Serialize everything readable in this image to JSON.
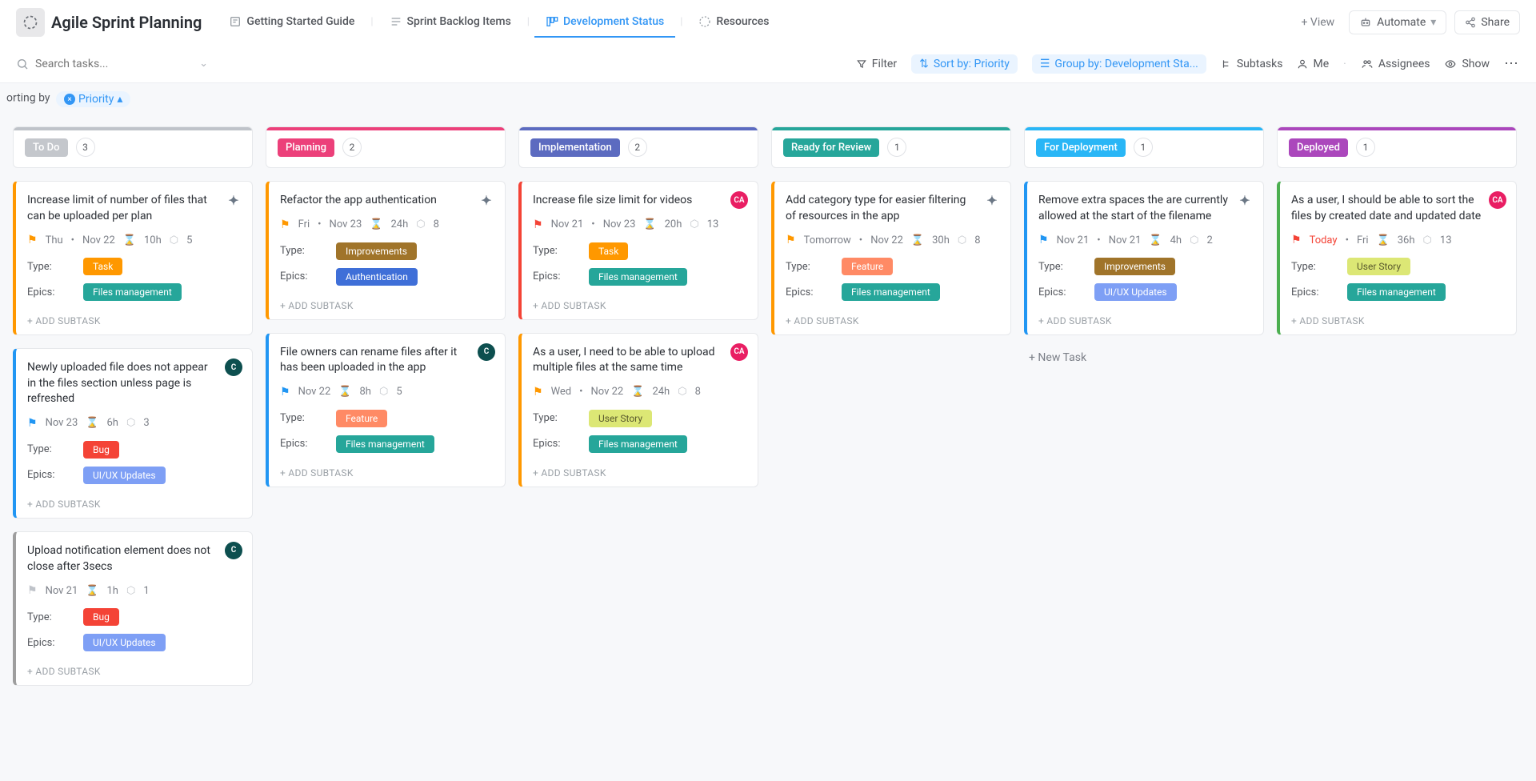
{
  "workspace": {
    "title": "Agile Sprint Planning"
  },
  "tabs": [
    {
      "label": "Getting Started Guide",
      "active": false
    },
    {
      "label": "Sprint Backlog Items",
      "active": false
    },
    {
      "label": "Development Status",
      "active": true
    },
    {
      "label": "Resources",
      "active": false
    }
  ],
  "addView": "+ View",
  "automate": "Automate",
  "share": "Share",
  "search": {
    "placeholder": "Search tasks..."
  },
  "toolbar": {
    "filter": "Filter",
    "sortBy": "Sort by: Priority",
    "groupBy": "Group by: Development Sta...",
    "subtasks": "Subtasks",
    "me": "Me",
    "assignees": "Assignees",
    "show": "Show"
  },
  "sortingBy": "orting by",
  "sortChip": "Priority",
  "addSubtask": "+ ADD SUBTASK",
  "newTask": "+ New Task",
  "fieldLabels": {
    "type": "Type:",
    "epics": "Epics:"
  },
  "columns": [
    {
      "name": "To Do",
      "count": "3",
      "color": "gray",
      "cards": [
        {
          "title": "Increase limit of number of files that can be uploaded per plan",
          "avatar": "sparkle",
          "flag": "orange",
          "start": "Thu",
          "end": "Nov 22",
          "est": "10h",
          "pts": "5",
          "type": "Task",
          "typeClass": "t-task",
          "epic": "Files management",
          "epicClass": "t-files",
          "prio": "high"
        },
        {
          "title": "Newly uploaded file does not appear in the files section unless page is refreshed",
          "avatar": "teal",
          "avText": "C",
          "flag": "blue",
          "start": "",
          "end": "Nov 23",
          "est": "6h",
          "pts": "3",
          "type": "Bug",
          "typeClass": "t-bug",
          "epic": "UI/UX Updates",
          "epicClass": "t-uiux",
          "prio": "normal"
        },
        {
          "title": "Upload notification element does not close after 3secs",
          "avatar": "teal",
          "avText": "C",
          "flag": "gray",
          "start": "",
          "end": "Nov 21",
          "est": "1h",
          "pts": "1",
          "type": "Bug",
          "typeClass": "t-bug",
          "epic": "UI/UX Updates",
          "epicClass": "t-uiux",
          "prio": "low"
        }
      ]
    },
    {
      "name": "Planning",
      "count": "2",
      "color": "pink",
      "cards": [
        {
          "title": "Refactor the app authentication",
          "avatar": "sparkle",
          "flag": "orange",
          "start": "Fri",
          "end": "Nov 23",
          "est": "24h",
          "pts": "8",
          "type": "Improvements",
          "typeClass": "t-improve",
          "epic": "Authentication",
          "epicClass": "t-auth",
          "prio": "high"
        },
        {
          "title": "File owners can rename files after it has been uploaded in the app",
          "avatar": "teal",
          "avText": "C",
          "flag": "blue",
          "start": "",
          "end": "Nov 22",
          "est": "8h",
          "pts": "5",
          "type": "Feature",
          "typeClass": "t-feature",
          "epic": "Files management",
          "epicClass": "t-files",
          "prio": "normal"
        }
      ]
    },
    {
      "name": "Implementation",
      "count": "2",
      "color": "blue",
      "cards": [
        {
          "title": "Increase file size limit for videos",
          "avatar": "pink",
          "avText": "CA",
          "flag": "red",
          "start": "Nov 21",
          "end": "Nov 23",
          "est": "20h",
          "pts": "13",
          "type": "Task",
          "typeClass": "t-task",
          "epic": "Files management",
          "epicClass": "t-files",
          "prio": "urgent"
        },
        {
          "title": "As a user, I need to be able to upload multiple files at the same time",
          "avatar": "pink",
          "avText": "CA",
          "flag": "orange",
          "start": "Wed",
          "end": "Nov 22",
          "est": "24h",
          "pts": "8",
          "type": "User Story",
          "typeClass": "t-userstory",
          "epic": "Files management",
          "epicClass": "t-files",
          "prio": "high"
        }
      ]
    },
    {
      "name": "Ready for Review",
      "count": "1",
      "color": "teal",
      "cards": [
        {
          "title": "Add category type for easier filtering of resources in the app",
          "avatar": "sparkle",
          "flag": "orange",
          "start": "Tomorrow",
          "end": "Nov 22",
          "est": "30h",
          "pts": "8",
          "type": "Feature",
          "typeClass": "t-feature",
          "epic": "Files management",
          "epicClass": "t-files",
          "prio": "high"
        }
      ]
    },
    {
      "name": "For Deployment",
      "count": "1",
      "color": "cyan",
      "cards": [
        {
          "title": "Remove extra spaces the are currently allowed at the start of the filename",
          "avatar": "sparkle",
          "flag": "blue",
          "start": "Nov 21",
          "end": "Nov 21",
          "est": "4h",
          "pts": "2",
          "type": "Improvements",
          "typeClass": "t-improve",
          "epic": "UI/UX Updates",
          "epicClass": "t-uiux",
          "prio": "normal"
        }
      ],
      "showNewTask": true
    },
    {
      "name": "Deployed",
      "count": "1",
      "color": "purple",
      "cards": [
        {
          "title": "As a user, I should be able to sort the files by created date and updated date",
          "avatar": "pink",
          "avText": "CA",
          "flag": "red",
          "start": "Today",
          "end": "Fri",
          "est": "36h",
          "pts": "13",
          "type": "User Story",
          "typeClass": "t-userstory",
          "epic": "Files management",
          "epicClass": "t-files",
          "prio": "green",
          "startRed": true
        }
      ]
    }
  ]
}
